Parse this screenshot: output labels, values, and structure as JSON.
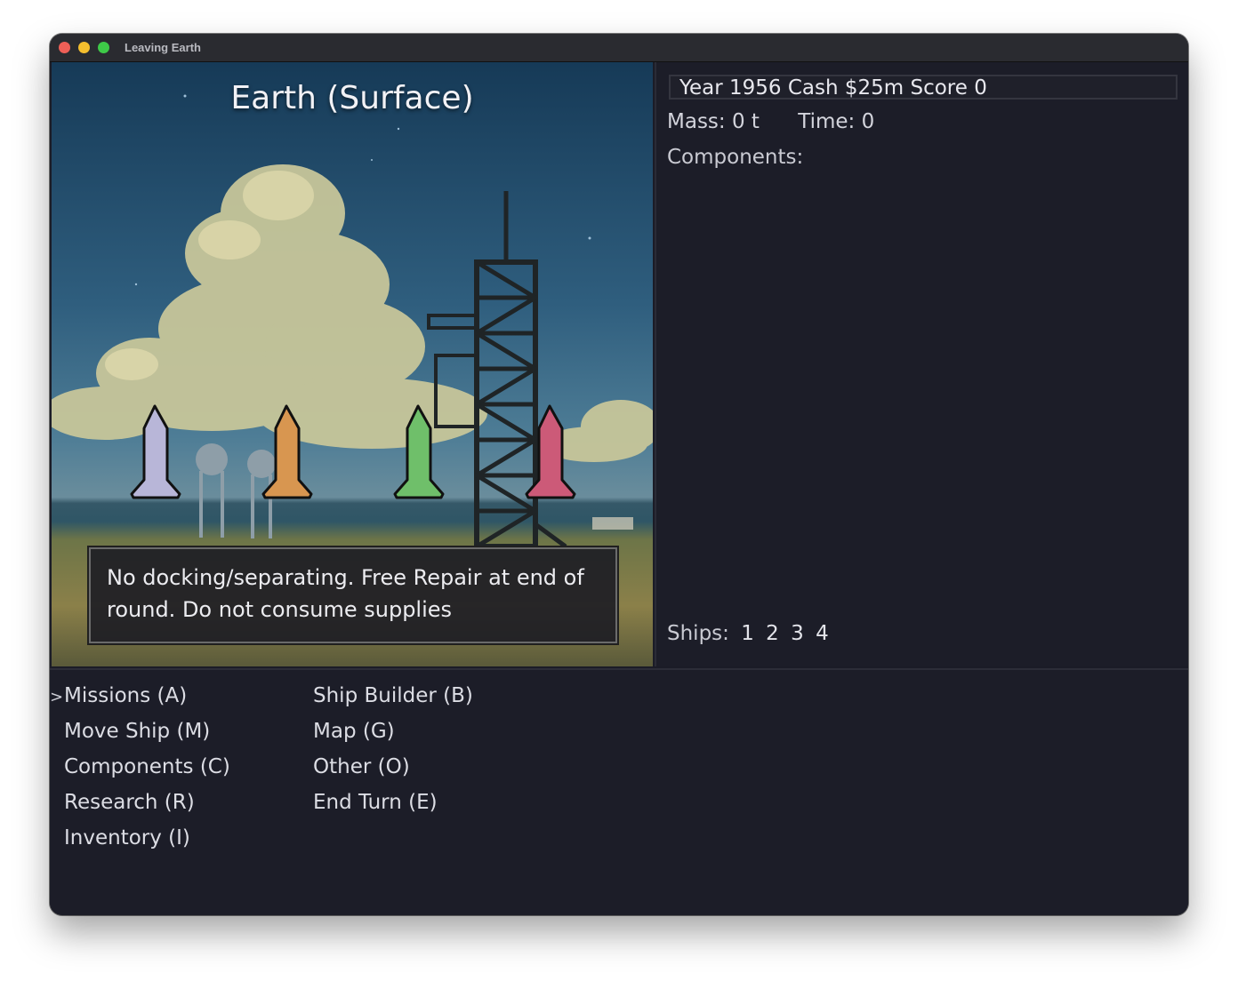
{
  "window": {
    "title": "Leaving Earth"
  },
  "scene": {
    "title": "Earth (Surface)",
    "info": "No docking/separating. Free Repair at end of round. Do not consume supplies",
    "rocket_colors": [
      "#b8b6d8",
      "#d89650",
      "#6fbf6a",
      "#cc5a78"
    ]
  },
  "status": {
    "summary": "Year 1956 Cash $25m Score 0",
    "mass": "Mass: 0 t",
    "time": "Time: 0",
    "components_label": "Components:",
    "ships_label": "Ships:",
    "ships": [
      "1",
      "2",
      "3",
      "4"
    ]
  },
  "menu": {
    "cursor": ">",
    "col1": [
      "Missions (A)",
      "Move Ship (M)",
      "Components (C)",
      "Research (R)",
      "Inventory (I)"
    ],
    "col2": [
      "Ship Builder (B)",
      "Map (G)",
      "Other (O)",
      "End Turn (E)"
    ]
  }
}
